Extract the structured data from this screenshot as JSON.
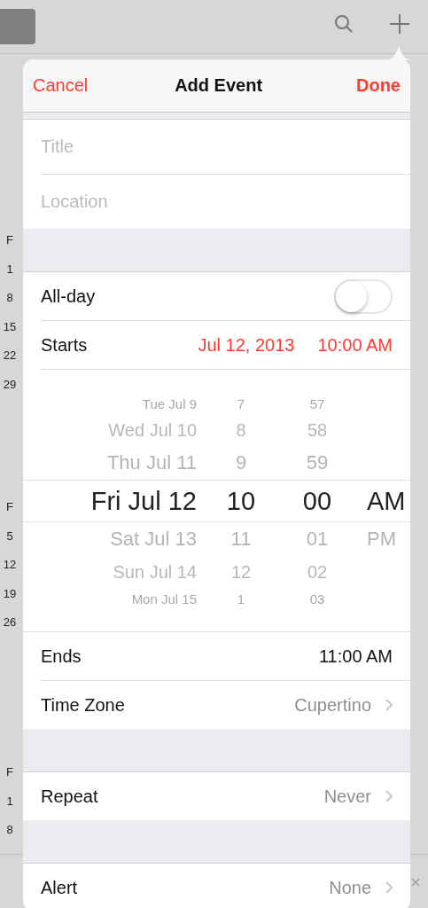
{
  "calendar_days": [
    [
      "F",
      "1",
      "8",
      "15",
      "22",
      "29"
    ],
    [
      "F",
      "5",
      "12",
      "19",
      "26"
    ],
    [
      "F",
      "1",
      "8"
    ]
  ],
  "popover": {
    "cancel": "Cancel",
    "title": "Add Event",
    "done": "Done"
  },
  "fields": [
    {
      "placeholder": "Title"
    },
    {
      "placeholder": "Location"
    }
  ],
  "all_day": {
    "label": "All-day",
    "on": false
  },
  "starts": {
    "label": "Starts",
    "date": "Jul 12, 2013",
    "time": "10:00 AM"
  },
  "picker": [
    {
      "items": [
        {
          "text": "Tue Jul 9",
          "selected": false
        },
        {
          "text": "Wed Jul 10",
          "selected": false
        },
        {
          "text": "Thu Jul 11",
          "selected": false
        },
        {
          "text": "Fri Jul 12",
          "selected": true
        },
        {
          "text": "Sat Jul 13",
          "selected": false
        },
        {
          "text": "Sun Jul 14",
          "selected": false
        },
        {
          "text": "Mon Jul 15",
          "selected": false
        }
      ]
    },
    {
      "items": [
        {
          "text": "7",
          "selected": false
        },
        {
          "text": "8",
          "selected": false
        },
        {
          "text": "9",
          "selected": false
        },
        {
          "text": "10",
          "selected": true
        },
        {
          "text": "11",
          "selected": false
        },
        {
          "text": "12",
          "selected": false
        },
        {
          "text": "1",
          "selected": false
        }
      ]
    },
    {
      "items": [
        {
          "text": "57",
          "selected": false
        },
        {
          "text": "58",
          "selected": false
        },
        {
          "text": "59",
          "selected": false
        },
        {
          "text": "00",
          "selected": true
        },
        {
          "text": "01",
          "selected": false
        },
        {
          "text": "02",
          "selected": false
        },
        {
          "text": "03",
          "selected": false
        }
      ]
    },
    {
      "items": [
        {
          "text": "AM",
          "selected": true
        },
        {
          "text": "PM",
          "selected": false
        }
      ]
    }
  ],
  "rows_after_picker": [
    {
      "label": "Ends",
      "value": "11:00 AM",
      "chevron": false
    },
    {
      "label": "Time Zone",
      "value": "Cupertino",
      "chevron": true
    }
  ],
  "repeat": {
    "label": "Repeat",
    "value": "Never",
    "chevron": true
  },
  "alert": {
    "label": "Alert",
    "value": "None",
    "chevron": true
  }
}
